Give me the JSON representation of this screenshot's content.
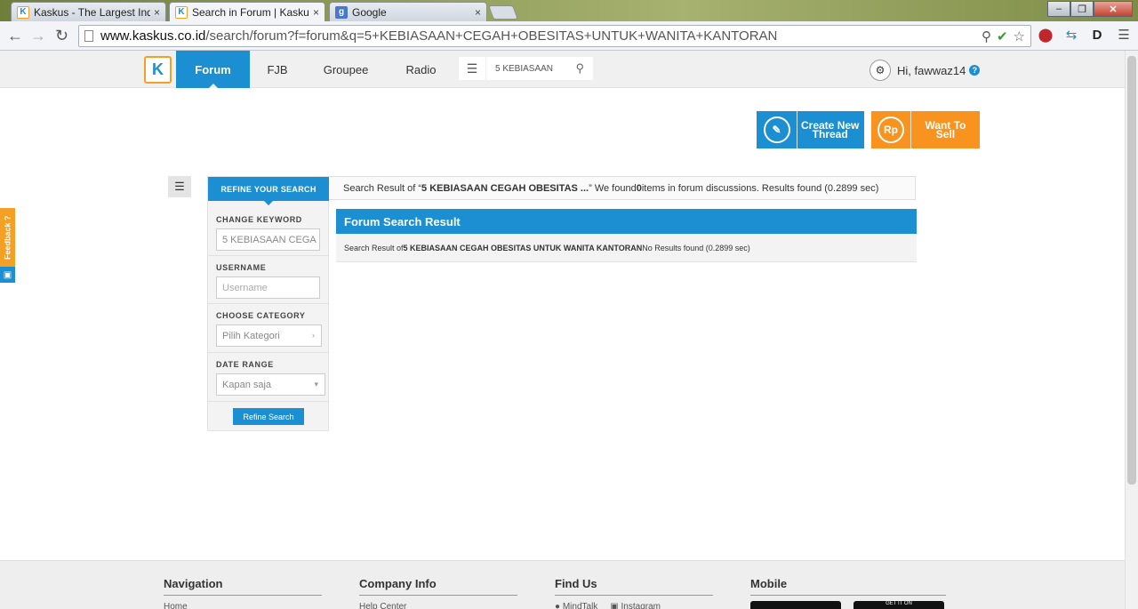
{
  "browser": {
    "tabs": [
      {
        "title": "Kaskus - The Largest Indo",
        "close": "×",
        "icon": "kaskus-favicon",
        "active": false
      },
      {
        "title": "Search in Forum | Kaskus",
        "close": "×",
        "icon": "kaskus-favicon",
        "active": true
      },
      {
        "title": "Google",
        "close": "×",
        "icon": "google-favicon",
        "active": false
      }
    ],
    "url_host": "www.kaskus.co.id",
    "url_path": "/search/forum?f=forum&q=5+KEBIASAAN+CEGAH+OBESITAS+UNTUK+WANITA+KANTORAN"
  },
  "header": {
    "logo": "K",
    "nav": [
      {
        "label": "Forum",
        "active": true
      },
      {
        "label": "FJB",
        "active": false
      },
      {
        "label": "Groupee",
        "active": false
      },
      {
        "label": "Radio",
        "active": false
      }
    ],
    "search_value": "5 KEBIASAAN",
    "user_greeting": "Hi, fawwaz14",
    "help_glyph": "?"
  },
  "actions": {
    "create_line1": "Create New",
    "create_line2": "Thread",
    "sell_icon": "Rp",
    "sell_label": "Want To Sell"
  },
  "sidebar": {
    "refine_tab": "REFINE YOUR SEARCH",
    "keyword_label": "CHANGE KEYWORD",
    "keyword_value": "5 KEBIASAAN CEGA",
    "username_label": "USERNAME",
    "username_placeholder": "Username",
    "category_label": "CHOOSE CATEGORY",
    "category_value": "Pilih Kategori",
    "date_label": "DATE RANGE",
    "date_value": "Kapan saja",
    "refine_button": "Refine Search"
  },
  "summary": {
    "prefix": "Search Result of “",
    "query": "5 KEBIASAAN CEGAH OBESITAS ...",
    "middle": "” We found ",
    "count": "0",
    "suffix": " items in forum discussions. Results found (0.2899 sec)"
  },
  "result": {
    "title": "Forum Search Result",
    "prefix": "Search Result of ",
    "query": "5 KEBIASAAN CEGAH OBESITAS UNTUK WANITA KANTORAN",
    "suffix": " No Results found (0.2899 sec)"
  },
  "feedback": "Feedback ?",
  "footer": {
    "navigation": {
      "title": "Navigation",
      "first": "Home"
    },
    "company": {
      "title": "Company Info",
      "first": "Help Center"
    },
    "findus": {
      "title": "Find Us",
      "items": [
        "MindTalk",
        "Instagram"
      ]
    },
    "mobile": {
      "title": "Mobile",
      "store2": "GET IT ON"
    }
  },
  "colors": {
    "brand_blue": "#1b8fd1",
    "brand_orange": "#f7931e"
  }
}
